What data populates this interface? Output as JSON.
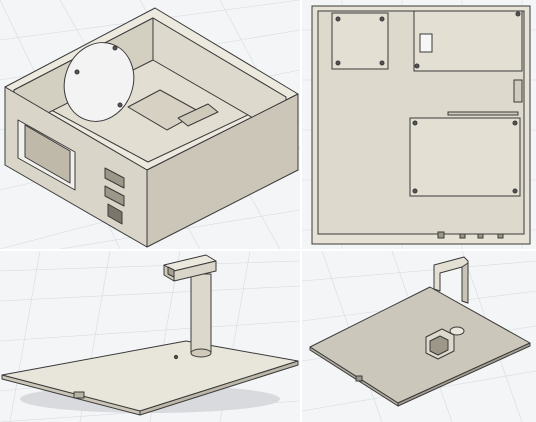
{
  "views": [
    {
      "id": "enclosure-iso",
      "subject": "enclosure-box-isometric"
    },
    {
      "id": "enclosure-top",
      "subject": "enclosure-box-top"
    },
    {
      "id": "stand-iso",
      "subject": "stand-plate-isometric"
    },
    {
      "id": "plate-iso",
      "subject": "mounting-plate-isometric"
    }
  ],
  "colors": {
    "part_top": "#e9e6dc",
    "part_left": "#d6d2c4",
    "part_right": "#c9c4b5",
    "edge": "#3a3a3a",
    "grid": "#d7dbe0",
    "background": "#f4f5f6"
  }
}
